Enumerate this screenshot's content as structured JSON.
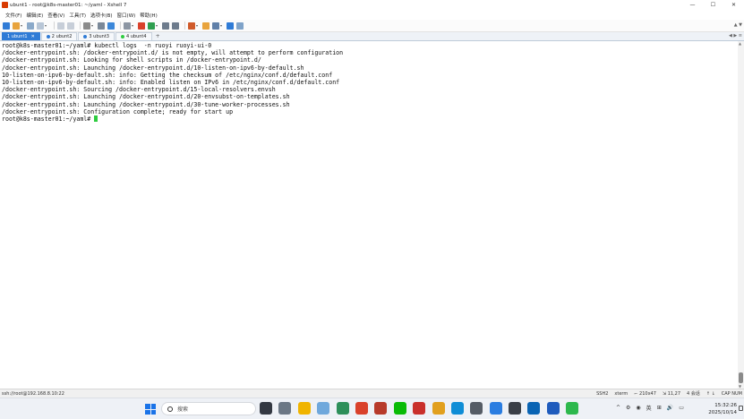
{
  "window": {
    "title": "ubunt1 - root@k8s-master01: ~/yaml - Xshell 7",
    "controls": {
      "minimize": "—",
      "maximize": "☐",
      "close": "✕"
    }
  },
  "menu": [
    "文件(F)",
    "编辑(E)",
    "查看(V)",
    "工具(T)",
    "选项卡(B)",
    "窗口(W)",
    "帮助(H)"
  ],
  "toolbar": {
    "buttons": [
      {
        "name": "new-session",
        "color": "#2f7bd6"
      },
      {
        "name": "open-folder",
        "color": "#e8a33c"
      },
      {
        "name": "connect",
        "color": "#8aa9c9"
      },
      {
        "name": "disconnect",
        "color": "#b8c6d6"
      },
      {
        "name": "copy",
        "color": "#c7ced8"
      },
      {
        "name": "paste",
        "color": "#c7ced8"
      },
      {
        "name": "find",
        "color": "#8a8a8a"
      },
      {
        "name": "properties",
        "color": "#7a8898"
      },
      {
        "name": "globe",
        "color": "#3b87d9"
      },
      {
        "name": "script",
        "color": "#8c96a3"
      },
      {
        "name": "xftp",
        "color": "#d9412b"
      },
      {
        "name": "xmanager",
        "color": "#2e9e4f"
      },
      {
        "name": "lock",
        "color": "#6d7b8c"
      },
      {
        "name": "keyboard",
        "color": "#6d7b8c"
      },
      {
        "name": "highlight",
        "color": "#d05a2a"
      },
      {
        "name": "folder",
        "color": "#e8a33c"
      },
      {
        "name": "layout",
        "color": "#5f7fa8"
      },
      {
        "name": "help",
        "color": "#2f7bd6"
      },
      {
        "name": "chat",
        "color": "#7fa3c9"
      }
    ],
    "right_arrows": "▲ ▼"
  },
  "tabs": [
    {
      "label": "1 ubunt1",
      "active": true,
      "dot": "#2f7bd6"
    },
    {
      "label": "2 ubunt2",
      "active": false,
      "dot": "#2f7bd6"
    },
    {
      "label": "3 ubunt3",
      "active": false,
      "dot": "#2f7bd6"
    },
    {
      "label": "4 ubunt4",
      "active": false,
      "dot": "#2ecc40"
    }
  ],
  "tab_add": "+",
  "tab_nav": "◀ ▶ ≡",
  "terminal": {
    "lines": [
      "root@k8s-master01:~/yaml# kubectl logs  -n ruoyi ruoyi-ui-0",
      "/docker-entrypoint.sh: /docker-entrypoint.d/ is not empty, will attempt to perform configuration",
      "/docker-entrypoint.sh: Looking for shell scripts in /docker-entrypoint.d/",
      "/docker-entrypoint.sh: Launching /docker-entrypoint.d/10-listen-on-ipv6-by-default.sh",
      "10-listen-on-ipv6-by-default.sh: info: Getting the checksum of /etc/nginx/conf.d/default.conf",
      "10-listen-on-ipv6-by-default.sh: info: Enabled listen on IPv6 in /etc/nginx/conf.d/default.conf",
      "/docker-entrypoint.sh: Sourcing /docker-entrypoint.d/15-local-resolvers.envsh",
      "/docker-entrypoint.sh: Launching /docker-entrypoint.d/20-envsubst-on-templates.sh",
      "/docker-entrypoint.sh: Launching /docker-entrypoint.d/30-tune-worker-processes.sh",
      "/docker-entrypoint.sh: Configuration complete; ready for start up"
    ],
    "prompt": "root@k8s-master01:~/yaml# "
  },
  "status": {
    "connection": "ssh://root@192.168.8.10:22",
    "protocol": "SSH2",
    "term": "xterm",
    "size": "⌐ 210x47",
    "position": "⇲ 11,27",
    "sessions": "4 会话",
    "arrows": "↑ ↓",
    "caps": "CAP NUM"
  },
  "taskbar": {
    "search_placeholder": "搜索",
    "apps": [
      {
        "name": "file-explorer",
        "color": "#333842"
      },
      {
        "name": "settings",
        "color": "#6b7785"
      },
      {
        "name": "folder",
        "color": "#f0b400"
      },
      {
        "name": "edge-dev",
        "color": "#6fa8dc"
      },
      {
        "name": "photos",
        "color": "#2d8f5a"
      },
      {
        "name": "xshell",
        "color": "#d9412b"
      },
      {
        "name": "xftp",
        "color": "#b73a2b"
      },
      {
        "name": "wechat",
        "color": "#09bb07"
      },
      {
        "name": "app-red",
        "color": "#c9302c"
      },
      {
        "name": "chrome",
        "color": "#e1a01f"
      },
      {
        "name": "edge",
        "color": "#0f8dd6"
      },
      {
        "name": "app-gray",
        "color": "#555c66"
      },
      {
        "name": "feishu",
        "color": "#2a7de1"
      },
      {
        "name": "app-dark",
        "color": "#3a3f47"
      },
      {
        "name": "vscode",
        "color": "#0a64b4"
      },
      {
        "name": "word",
        "color": "#1e5bbd"
      },
      {
        "name": "app-green",
        "color": "#2db84d"
      }
    ],
    "tray": [
      "^",
      "⚙",
      "◉",
      "英",
      "⊞",
      "🔊",
      "▭"
    ],
    "time": "15:32:26",
    "date": "2025/10/14"
  }
}
